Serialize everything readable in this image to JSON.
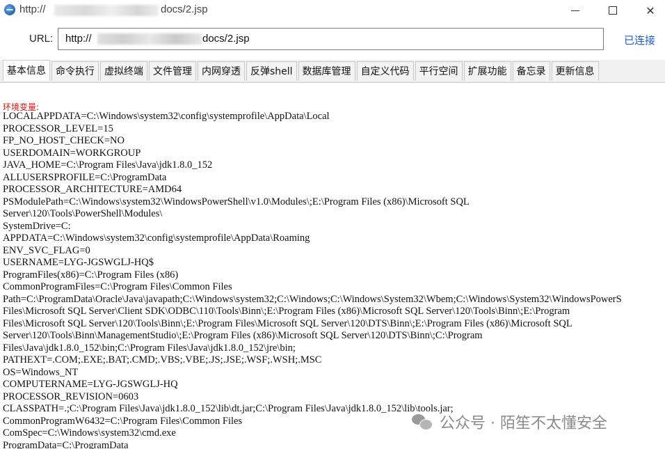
{
  "window": {
    "title_prefix": "http://",
    "title_suffix": "docs/2.jsp",
    "controls": {
      "minimize": "–",
      "maximize": "□",
      "close": "✕"
    }
  },
  "address": {
    "label": "URL:",
    "value_prefix": "http://",
    "value_suffix": "docs/2.jsp",
    "status": "已连接"
  },
  "tabs": [
    {
      "label": "基本信息",
      "active": true
    },
    {
      "label": "命令执行",
      "active": false
    },
    {
      "label": "虚拟终端",
      "active": false
    },
    {
      "label": "文件管理",
      "active": false
    },
    {
      "label": "内网穿透",
      "active": false
    },
    {
      "label": "反弹shell",
      "active": false
    },
    {
      "label": "数据库管理",
      "active": false
    },
    {
      "label": "自定义代码",
      "active": false
    },
    {
      "label": "平行空间",
      "active": false
    },
    {
      "label": "扩展功能",
      "active": false
    },
    {
      "label": "备忘录",
      "active": false
    },
    {
      "label": "更新信息",
      "active": false
    }
  ],
  "content": {
    "section_title": "环境变量:",
    "lines": [
      "LOCALAPPDATA=C:\\Windows\\system32\\config\\systemprofile\\AppData\\Local",
      "PROCESSOR_LEVEL=15",
      "FP_NO_HOST_CHECK=NO",
      "USERDOMAIN=WORKGROUP",
      "JAVA_HOME=C:\\Program Files\\Java\\jdk1.8.0_152",
      "ALLUSERSPROFILE=C:\\ProgramData",
      "PROCESSOR_ARCHITECTURE=AMD64",
      "PSModulePath=C:\\Windows\\system32\\WindowsPowerShell\\v1.0\\Modules\\;E:\\Program Files (x86)\\Microsoft SQL",
      "Server\\120\\Tools\\PowerShell\\Modules\\",
      "SystemDrive=C:",
      "APPDATA=C:\\Windows\\system32\\config\\systemprofile\\AppData\\Roaming",
      "ENV_SVC_FLAG=0",
      "USERNAME=LYG-JGSWGLJ-HQ$",
      "ProgramFiles(x86)=C:\\Program Files (x86)",
      "CommonProgramFiles=C:\\Program Files\\Common Files",
      "Path=C:\\ProgramData\\Oracle\\Java\\javapath;C:\\Windows\\system32;C:\\Windows;C:\\Windows\\System32\\Wbem;C:\\Windows\\System32\\WindowsPowerS",
      "Files\\Microsoft SQL Server\\Client SDK\\ODBC\\110\\Tools\\Binn\\;E:\\Program Files (x86)\\Microsoft SQL Server\\120\\Tools\\Binn\\;E:\\Program",
      "Files\\Microsoft SQL Server\\120\\Tools\\Binn\\;E:\\Program Files\\Microsoft SQL Server\\120\\DTS\\Binn\\;E:\\Program Files (x86)\\Microsoft SQL",
      "Server\\120\\Tools\\Binn\\ManagementStudio\\;E:\\Program Files (x86)\\Microsoft SQL Server\\120\\DTS\\Binn\\;C:\\Program",
      "Files\\Java\\jdk1.8.0_152\\bin;C:\\Program Files\\Java\\jdk1.8.0_152\\jre\\bin;",
      "PATHEXT=.COM;.EXE;.BAT;.CMD;.VBS;.VBE;.JS;.JSE;.WSF;.WSH;.MSC",
      "OS=Windows_NT",
      "COMPUTERNAME=LYG-JGSWGLJ-HQ",
      "PROCESSOR_REVISION=0603",
      "CLASSPATH=.;C:\\Program Files\\Java\\jdk1.8.0_152\\lib\\dt.jar;C:\\Program Files\\Java\\jdk1.8.0_152\\lib\\tools.jar;",
      "CommonProgramW6432=C:\\Program Files\\Common Files",
      "ComSpec=C:\\Windows\\system32\\cmd.exe",
      "ProgramData=C:\\ProgramData"
    ]
  },
  "watermark": {
    "text": "公众号 · 陌笙不太懂安全",
    "icon": "wechat-icon"
  }
}
